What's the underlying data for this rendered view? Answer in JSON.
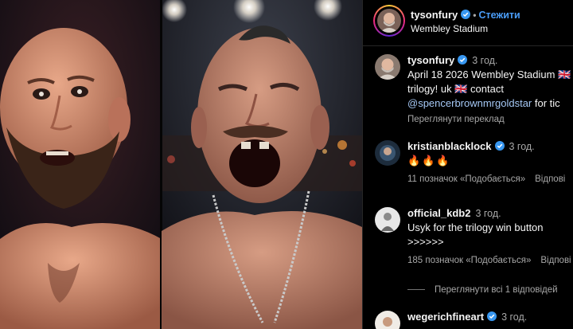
{
  "header": {
    "username": "tysonfury",
    "follow_label": "Стежити",
    "location": "Wembley Stadium",
    "separator": "•"
  },
  "caption": {
    "username": "tysonfury",
    "time": "3 год.",
    "lines": [
      "April 18 2026 Wembley Stadium 🇬🇧",
      "trilogy! uk 🇬🇧 contact"
    ],
    "mention": "@spencerbrownmrgoldstar",
    "mention_tail": " for tic",
    "translate": "Переглянути переклад"
  },
  "comments": [
    {
      "username": "kristianblacklock",
      "time": "3 год.",
      "text": "🔥🔥🔥",
      "likes": "11 позначок «Подобається»",
      "reply": "Відпові"
    },
    {
      "username": "official_kdb2",
      "time": "3 год.",
      "text_lines": [
        "Usyk for the trilogy win button",
        ">>>>>>"
      ],
      "likes": "185 позначок «Подобається»",
      "reply": "Відпові"
    },
    {
      "username": "wegerichfineart",
      "time": "3 год."
    }
  ],
  "view_replies": "Переглянути всі 1 відповідей",
  "icons": {
    "verified": "verified-badge-icon",
    "skin_tone": "#d89a7a",
    "verified_color": "#3897f0",
    "link_color": "#4a9df8"
  }
}
